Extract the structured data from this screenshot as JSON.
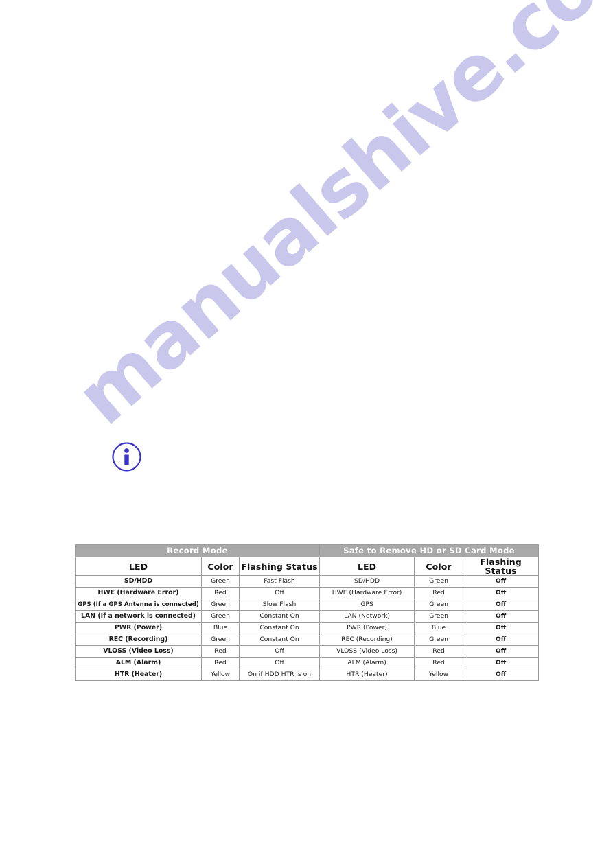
{
  "page": {
    "background_color": "#ffffff",
    "watermark": {
      "text": "manualshive.com",
      "color": "#c7c5ea"
    }
  },
  "note": {
    "icon": "info-circle-icon",
    "icon_color": "#3a33cc"
  },
  "table": {
    "banner": {
      "left_label": "Record  Mode",
      "right_label": "Safe  to Remove HD or SD Card Mode",
      "background_color": "#a8a8a8",
      "text_color": "#ffffff"
    },
    "headers": {
      "left": [
        "LED",
        "Color",
        "Flashing Status"
      ],
      "right": [
        "LED",
        "Color",
        "Flashing Status"
      ]
    },
    "rows": [
      {
        "left_led": "SD/HDD",
        "left_color": "Green",
        "left_status": "Fast Flash",
        "right_led": "SD/HDD",
        "right_color": "Green",
        "right_status": "Off"
      },
      {
        "left_led": "HWE (Hardware Error)",
        "left_color": "Red",
        "left_status": "Off",
        "right_led": "HWE (Hardware Error)",
        "right_color": "Red",
        "right_status": "Off"
      },
      {
        "left_led": "GPS (If a GPS Antenna is connected)",
        "left_color": "Green",
        "left_status": "Slow Flash",
        "right_led": "GPS",
        "right_color": "Green",
        "right_status": "Off"
      },
      {
        "left_led": "LAN (If a network is connected)",
        "left_color": "Green",
        "left_status": "Constant On",
        "right_led": "LAN (Network)",
        "right_color": "Green",
        "right_status": "Off"
      },
      {
        "left_led": "PWR (Power)",
        "left_color": "Blue",
        "left_status": "Constant On",
        "right_led": "PWR (Power)",
        "right_color": "Blue",
        "right_status": "Off"
      },
      {
        "left_led": "REC (Recording)",
        "left_color": "Green",
        "left_status": "Constant On",
        "right_led": "REC (Recording)",
        "right_color": "Green",
        "right_status": "Off"
      },
      {
        "left_led": "VLOSS (Video Loss)",
        "left_color": "Red",
        "left_status": "Off",
        "right_led": "VLOSS (Video Loss)",
        "right_color": "Red",
        "right_status": "Off"
      },
      {
        "left_led": "ALM (Alarm)",
        "left_color": "Red",
        "left_status": "Off",
        "right_led": "ALM (Alarm)",
        "right_color": "Red",
        "right_status": "Off"
      },
      {
        "left_led": "HTR (Heater)",
        "left_color": "Yellow",
        "left_status": "On if HDD HTR is on",
        "right_led": "HTR (Heater)",
        "right_color": "Yellow",
        "right_status": "Off"
      }
    ]
  }
}
